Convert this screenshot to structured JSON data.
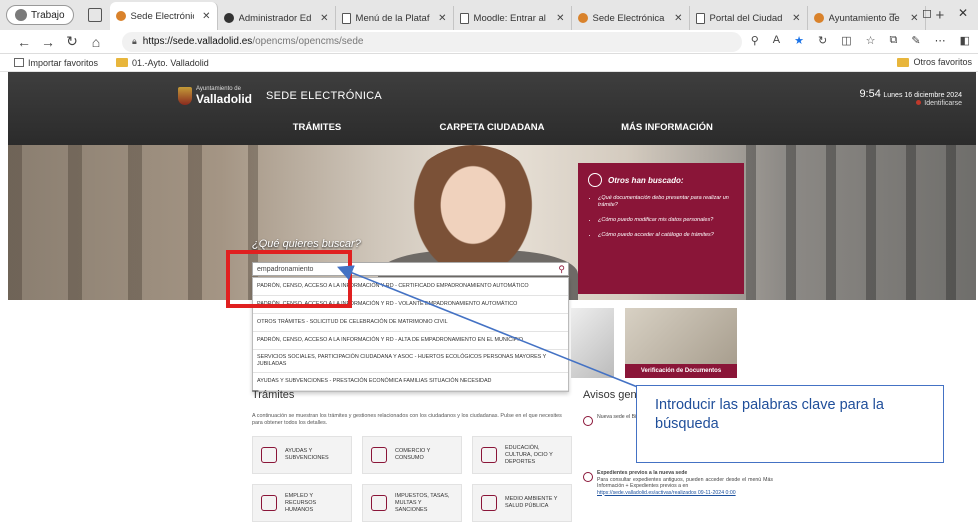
{
  "browser": {
    "profile": "Trabajo",
    "tabs": [
      {
        "label": "Sede Electrónica",
        "icon": "orange",
        "active": true
      },
      {
        "label": "Administrador Ed",
        "icon": "black"
      },
      {
        "label": "Menú de la Plataf",
        "icon": "page"
      },
      {
        "label": "Moodle: Entrar al",
        "icon": "page"
      },
      {
        "label": "Sede Electrónica",
        "icon": "orange"
      },
      {
        "label": "Portal del Ciudad",
        "icon": "page"
      },
      {
        "label": "Ayuntamiento de",
        "icon": "orange"
      }
    ],
    "url_host": "https://sede.valladolid.es",
    "url_path": "/opencms/opencms/sede",
    "bookmarks": [
      {
        "label": "Importar favoritos"
      },
      {
        "label": "01.-Ayto. Valladolid"
      }
    ],
    "bookmarks_right": "Otros favoritos"
  },
  "site": {
    "ayuntamiento": "Ayuntamiento de",
    "city": "Valladolid",
    "name": "SEDE ELECTRÓNICA",
    "time": "9:54",
    "date": "Lunes 16 diciembre 2024",
    "identify": "Identificarse",
    "nav": [
      "TRÁMITES",
      "CARPETA CIUDADANA",
      "MÁS INFORMACIÓN"
    ]
  },
  "search": {
    "question": "¿Qué quieres buscar?",
    "value": "empadronamiento",
    "suggestions": [
      "PADRÓN, CENSO, ACCESO A LA INFORMACIÓN Y RD - CERTIFICADO EMPADRONAMIENTO AUTOMÁTICO",
      "PADRÓN, CENSO, ACCESO A LA INFORMACIÓN Y RD - VOLANTE EMPADRONAMIENTO AUTOMÁTICO",
      "OTROS TRÁMITES - SOLICITUD DE CELEBRACIÓN DE MATRIMONIO CIVIL",
      "PADRÓN, CENSO, ACCESO A LA INFORMACIÓN Y RD - ALTA DE EMPADRONAMIENTO EN EL MUNICIPIO",
      "SERVICIOS SOCIALES, PARTICIPACIÓN CIUDADANA Y ASOC - HUERTOS ECOLÓGICOS PERSONAS MAYORES Y JUBILADAS",
      "AYUDAS Y SUBVENCIONES - PRESTACIÓN ECONÓMICA FAMILIAS SITUACIÓN NECESIDAD"
    ]
  },
  "otros": {
    "title": "Otros han buscado:",
    "items": [
      "¿Qué documentación debo presentar para realizar un trámite?",
      "¿Cómo puedo modificar mis datos personales?",
      "¿Cómo puedo acceder al catálogo de trámites?"
    ]
  },
  "tiles": {
    "verificacion": "Verificación de Documentos"
  },
  "tramites": {
    "title": "Trámites",
    "text": "A continuación se muestran los trámites y gestiones relacionados con los ciudadanos y los ciudadanas. Pulse en el que necesites para obtener todos los detalles.",
    "cards": [
      "AYUDAS Y\nSUBVENCIONES",
      "COMERCIO Y\nCONSUMO",
      "EDUCACIÓN,\nCULTURA, OCIO Y\nDEPORTES",
      "EMPLEO Y\nRECURSOS\nHUMANOS",
      "IMPUESTOS, TASAS,\nMULTAS Y\nSANCIONES",
      "MEDIO AMBIENTE Y\nSALUD PÚBLICA"
    ]
  },
  "avisos": {
    "title": "Avisos gene",
    "item1": "Nueva sede el Bienvenido a de Valladolid Aula, se en teléfono 0 @ava.es",
    "item2_title": "Expedientes previos a la nueva sede",
    "item2_text": "Para consultar expedientes antiguos, pueden acceder desde el menú Más Información + Expedientes previos a en",
    "item2_link": "https://sede.valladolid.es/activas/realizados 09-11-2024 0:00"
  },
  "callout": {
    "text": "Introducir las palabras clave para la búsqueda"
  },
  "colors": {
    "brand": "#8a1538",
    "highlight": "#e02020",
    "callout": "#4472c4"
  }
}
